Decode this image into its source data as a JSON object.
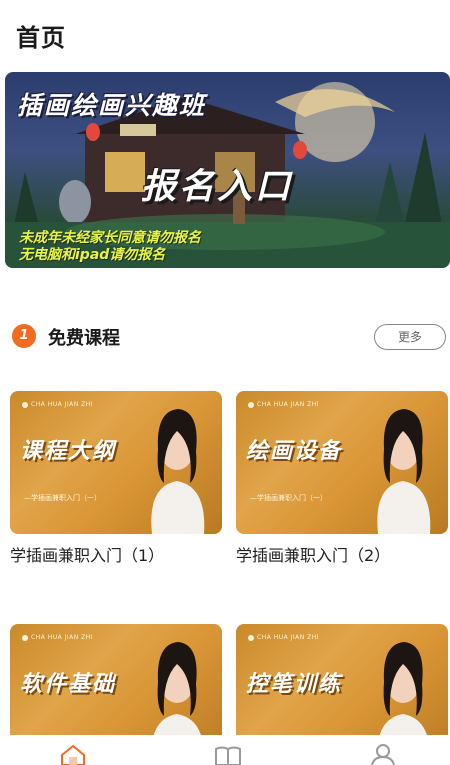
{
  "header": {
    "title": "首页"
  },
  "banner": {
    "title": "插画绘画兴趣班",
    "cta": "报名入口",
    "notes": [
      "未成年未经家长同意请勿报名",
      "无电脑和ipad请勿报名"
    ]
  },
  "section": {
    "number": "1",
    "title": "免费课程",
    "more_label": "更多"
  },
  "courses": [
    {
      "thumb_title": "课程大纲",
      "thumb_sub": "—学插画兼职入门（一）",
      "brand": "CHA HUA JIAN ZHI",
      "title": "学插画兼职入门（1）"
    },
    {
      "thumb_title": "绘画设备",
      "thumb_sub": "—学插画兼职入门（一）",
      "brand": "CHA HUA JIAN ZHI",
      "title": "学插画兼职入门（2）"
    },
    {
      "thumb_title": "软件基础",
      "thumb_sub": "",
      "brand": "CHA HUA JIAN ZHI",
      "title": ""
    },
    {
      "thumb_title": "控笔训练",
      "thumb_sub": "",
      "brand": "CHA HUA JIAN ZHI",
      "title": ""
    }
  ],
  "tabbar": {
    "items": [
      "home-icon",
      "book-icon",
      "profile-icon"
    ],
    "active_color": "#f26b21"
  },
  "colors": {
    "accent": "#f26b21",
    "thumb_gold": "#d99535"
  }
}
